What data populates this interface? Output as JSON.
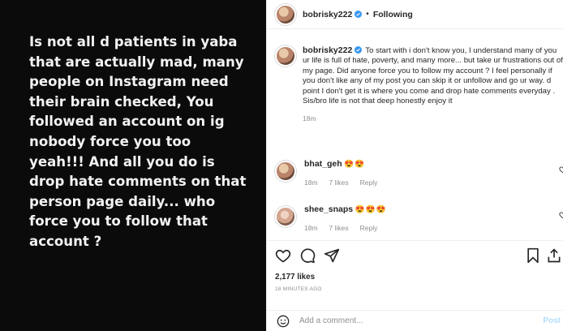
{
  "story": {
    "text": "Is not all d patients in yaba that are actually mad, many people on Instagram need their brain checked, You followed an account on ig nobody force you too yeah!!! And all you do is drop hate comments on that person page daily... who force you to follow that account ?"
  },
  "header": {
    "username": "bobrisky222",
    "separator": "•",
    "follow_status": "Following"
  },
  "caption": {
    "username": "bobrisky222",
    "text": "To start with i don't know you, I understand many of you ur life is full of hate, poverty, and many more... but take ur frustrations out of my page. Did anyone force you to follow my account ? I feel personally if you don't like any of my post you can skip it or unfollow and go ur way. d point I don't get it is where you come and drop hate comments everyday . Sis/bro life is not that deep honestly enjoy it",
    "time": "18m"
  },
  "comments": [
    {
      "username": "bhat_geh",
      "text": "😍😍",
      "time": "18m",
      "likes": "7 likes",
      "reply": "Reply"
    },
    {
      "username": "shee_snaps",
      "text": "😍😍😍",
      "time": "18m",
      "likes": "7 likes",
      "reply": "Reply"
    }
  ],
  "stats": {
    "likes": "2,177 likes",
    "posted": "18 MINUTES AGO"
  },
  "add_comment": {
    "placeholder": "Add a comment...",
    "post_label": "Post"
  },
  "icons": [
    "heart-icon",
    "comment-icon",
    "share-icon",
    "bookmark-icon",
    "verified-icon",
    "smile-icon"
  ],
  "colors": {
    "verified": "#3897f0",
    "post_disabled": "#b2dffc",
    "meta": "#8e8e8e"
  }
}
